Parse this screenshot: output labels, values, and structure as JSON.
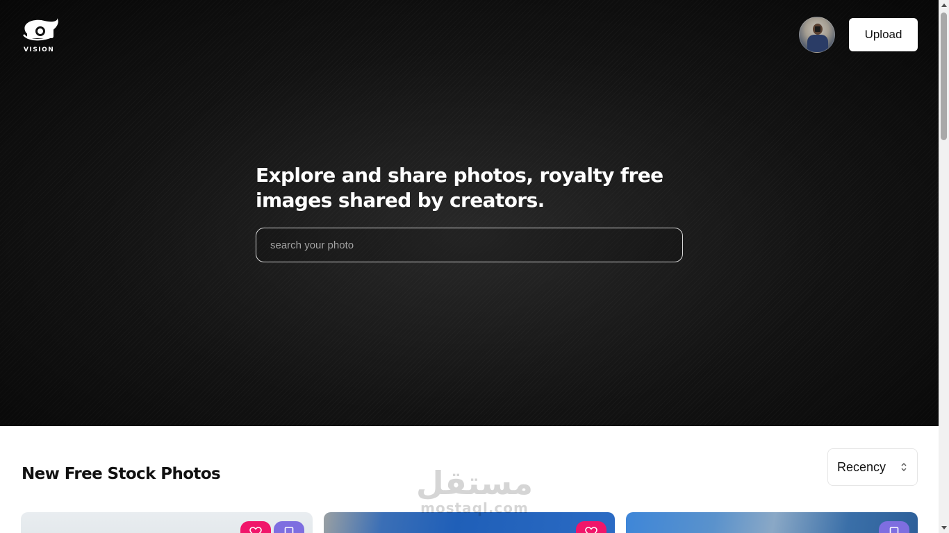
{
  "header": {
    "logo_text": "VISION",
    "upload_label": "Upload"
  },
  "hero": {
    "headline": "Explore and share photos, royalty free images shared by creators.",
    "search_placeholder": "search your photo"
  },
  "section": {
    "title": "New Free Stock Photos",
    "sort_value": "Recency"
  },
  "watermark": {
    "arabic": "مستقل",
    "latin": "mostaql.com"
  },
  "cards": [
    {
      "icons": [
        "heart-icon",
        "bookmark-icon"
      ]
    },
    {
      "icons": [
        "heart-icon"
      ]
    },
    {
      "icons": [
        "bookmark-icon"
      ]
    }
  ],
  "colors": {
    "hero_bg": "#121212",
    "like_button": "#f0166a",
    "save_button": "#7e6ee0"
  }
}
